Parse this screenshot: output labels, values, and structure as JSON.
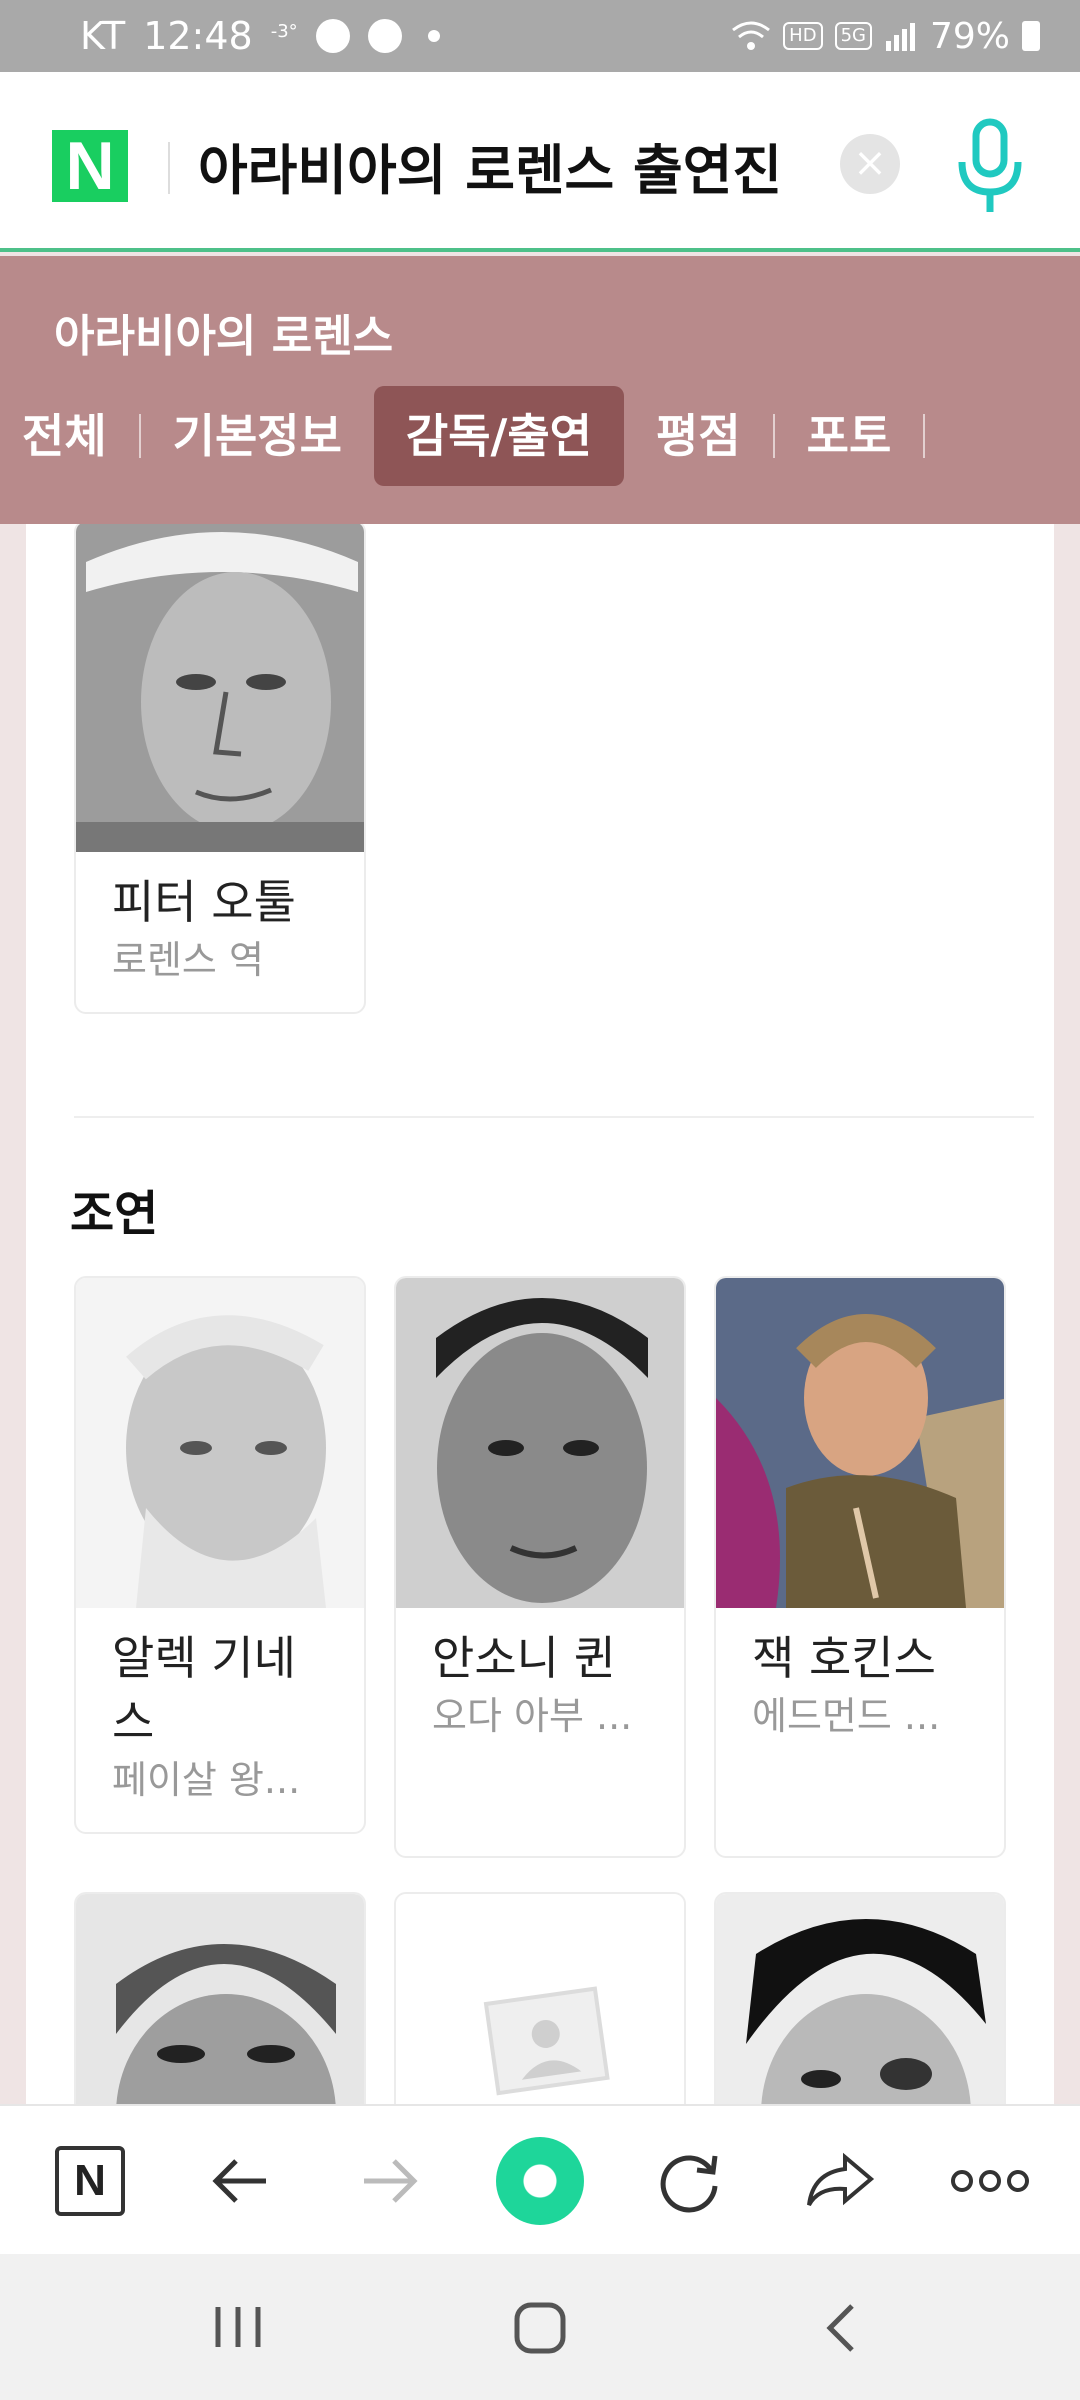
{
  "status_bar": {
    "carrier": "KT",
    "time": "12:48",
    "temperature": "-3°",
    "network": "5G",
    "hd_badge": "HD",
    "battery": "79%"
  },
  "search": {
    "logo": "N",
    "query": "아라비아의 로렌스 출연진"
  },
  "movie": {
    "title": "아라비아의 로렌스"
  },
  "tabs": [
    {
      "label": "전체"
    },
    {
      "label": "기본정보"
    },
    {
      "label": "감독/출연",
      "active": true
    },
    {
      "label": "평점"
    },
    {
      "label": "포토"
    }
  ],
  "lead_cast": [
    {
      "name": "피터 오툴",
      "role": "로렌스 역"
    }
  ],
  "supporting_section": {
    "title": "조연"
  },
  "supporting_cast": [
    {
      "name": "알렉 기네스",
      "role": "페이살 왕..."
    },
    {
      "name": "안소니 퀸",
      "role": "오다 아부 ..."
    },
    {
      "name": "잭 호킨스",
      "role": "에드먼드 ..."
    }
  ],
  "toolbar": {
    "home_label": "N"
  },
  "colors": {
    "accent_band": "#b88a8b",
    "active_tab": "#8e5556",
    "naver_green": "#19ce60"
  }
}
